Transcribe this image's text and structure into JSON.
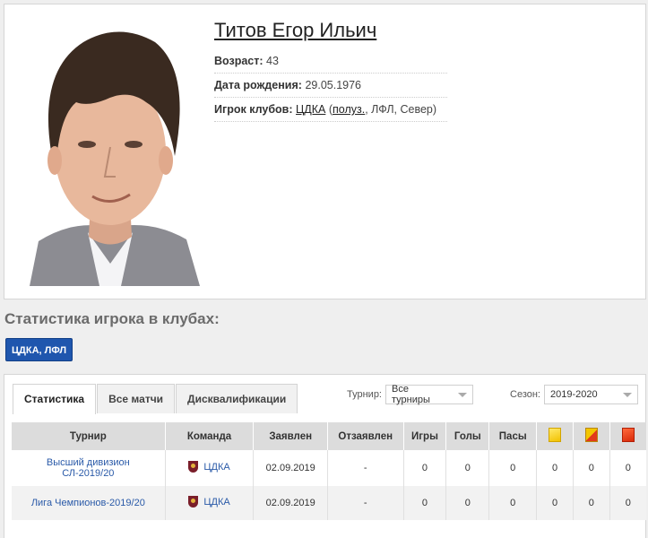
{
  "player": {
    "name": "Титов Егор Ильич",
    "age_label": "Возраст:",
    "age": "43",
    "birth_label": "Дата рождения:",
    "birth_date": "29.05.1976",
    "clubs_label": "Игрок клубов:",
    "club": "ЦДКА",
    "club_open": "(",
    "role": "полуз.",
    "club_rest": ", ЛФЛ, Север)"
  },
  "section_title": "Статистика игрока в клубах:",
  "club_badge": "ЦДКА, ЛФЛ",
  "tabs": [
    {
      "label": "Статистика",
      "active": true
    },
    {
      "label": "Все матчи",
      "active": false
    },
    {
      "label": "Дисквалификации",
      "active": false
    }
  ],
  "filters": {
    "tournament_label": "Турнир:",
    "tournament_value": "Все турниры",
    "season_label": "Сезон:",
    "season_value": "2019-2020"
  },
  "table": {
    "headers": [
      "Турнир",
      "Команда",
      "Заявлен",
      "Отзаявлен",
      "Игры",
      "Голы",
      "Пасы"
    ],
    "card_icons": [
      "yellow-card-icon",
      "yellow-red-card-icon",
      "red-card-icon"
    ],
    "rows": [
      {
        "tournament": "Высший дивизион СЛ-2019/20",
        "team": "ЦДКА",
        "registered": "02.09.2019",
        "unregistered": "-",
        "games": "0",
        "goals": "0",
        "assists": "0",
        "yellow": "0",
        "yellow_red": "0",
        "red": "0"
      },
      {
        "tournament": "Лига Чемпионов-2019/20",
        "team": "ЦДКА",
        "registered": "02.09.2019",
        "unregistered": "-",
        "games": "0",
        "goals": "0",
        "assists": "0",
        "yellow": "0",
        "yellow_red": "0",
        "red": "0"
      }
    ]
  },
  "colors": {
    "badge": "#1f56ae",
    "link": "#2a5aa8",
    "header_bg": "#dcdcdc"
  }
}
